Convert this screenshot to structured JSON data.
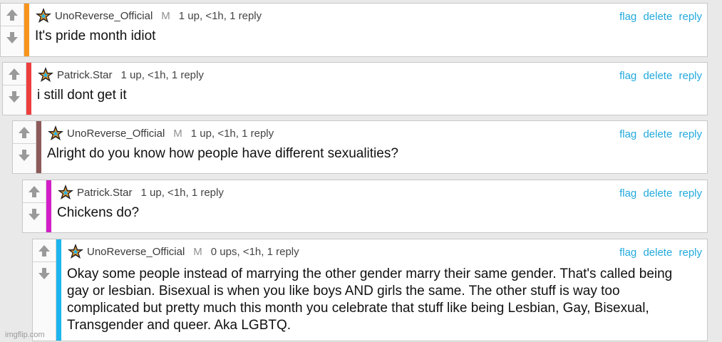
{
  "comments": [
    {
      "user": "UnoReverse_Official",
      "mod": "M",
      "meta": "1 up, <1h, 1 reply",
      "text": "It's pride month idiot",
      "bar_color": "#f7941d"
    },
    {
      "user": "Patrick.Star",
      "mod": "",
      "meta": "1 up, <1h, 1 reply",
      "text": "i still dont get it",
      "bar_color": "#ef3e3e"
    },
    {
      "user": "UnoReverse_Official",
      "mod": "M",
      "meta": "1 up, <1h, 1 reply",
      "text": "Alright do you know how people have different sexualities?",
      "bar_color": "#8c5a5a"
    },
    {
      "user": "Patrick.Star",
      "mod": "",
      "meta": "1 up, <1h, 1 reply",
      "text": "Chickens do?",
      "bar_color": "#d31ec8"
    },
    {
      "user": "UnoReverse_Official",
      "mod": "M",
      "meta": "0 ups, <1h, 1 reply",
      "text": "Okay some people instead of marrying the other gender marry their same gender. That's called being gay or lesbian. Bisexual is when you like boys AND girls the same. The other stuff is way too complicated but pretty much this month you celebrate that stuff like being Lesbian, Gay, Bisexual, Transgender and queer. Aka LGBTQ.",
      "bar_color": "#1cb5ee"
    }
  ],
  "actions": {
    "flag": "flag",
    "delete": "delete",
    "reply": "reply"
  },
  "icons": {
    "upvote": "arrow-up-icon",
    "downvote": "arrow-down-icon",
    "badge": "star-badge-icon"
  },
  "colors": {
    "action_link": "#22a9dc"
  },
  "watermark": "imgflip.com"
}
